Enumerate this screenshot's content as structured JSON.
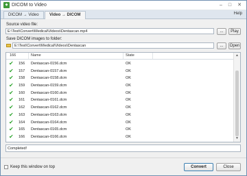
{
  "window": {
    "title": "DICOM to Video",
    "app_icon": "dicom-app-icon"
  },
  "tabs": [
    {
      "label": "DICOM → Video",
      "active": false
    },
    {
      "label": "Video → DICOM",
      "active": true
    }
  ],
  "help_label": "Help",
  "source": {
    "label": "Source video file:",
    "value": "E:\\Test\\Convert\\Medical\\Videos\\Dentascan.mp4",
    "browse_label": "...",
    "play_label": "Play"
  },
  "target": {
    "label": "Save DICOM images to folder:",
    "value": "E:\\Test\\Convert\\Medical\\Videos\\Dentascan",
    "browse_label": "...",
    "open_label": "Open"
  },
  "list": {
    "columns": [
      "166",
      "Name",
      "State"
    ],
    "rows": [
      {
        "num": "156",
        "name": "Dentascan-0156.dcm",
        "state": "OK"
      },
      {
        "num": "157",
        "name": "Dentascan-0157.dcm",
        "state": "OK"
      },
      {
        "num": "158",
        "name": "Dentascan-0158.dcm",
        "state": "OK"
      },
      {
        "num": "159",
        "name": "Dentascan-0159.dcm",
        "state": "OK"
      },
      {
        "num": "160",
        "name": "Dentascan-0160.dcm",
        "state": "OK"
      },
      {
        "num": "161",
        "name": "Dentascan-0161.dcm",
        "state": "OK"
      },
      {
        "num": "162",
        "name": "Dentascan-0162.dcm",
        "state": "OK"
      },
      {
        "num": "163",
        "name": "Dentascan-0163.dcm",
        "state": "OK"
      },
      {
        "num": "164",
        "name": "Dentascan-0164.dcm",
        "state": "OK"
      },
      {
        "num": "165",
        "name": "Dentascan-0165.dcm",
        "state": "OK"
      },
      {
        "num": "166",
        "name": "Dentascan-0166.dcm",
        "state": "OK"
      }
    ]
  },
  "status_text": "Completed!",
  "keep_on_top_label": "Keep this window on top",
  "convert_label": "Convert",
  "close_label": "Close",
  "colors": {
    "check_green": "#2fa52f",
    "tab_bar": "#dfe6ee"
  }
}
